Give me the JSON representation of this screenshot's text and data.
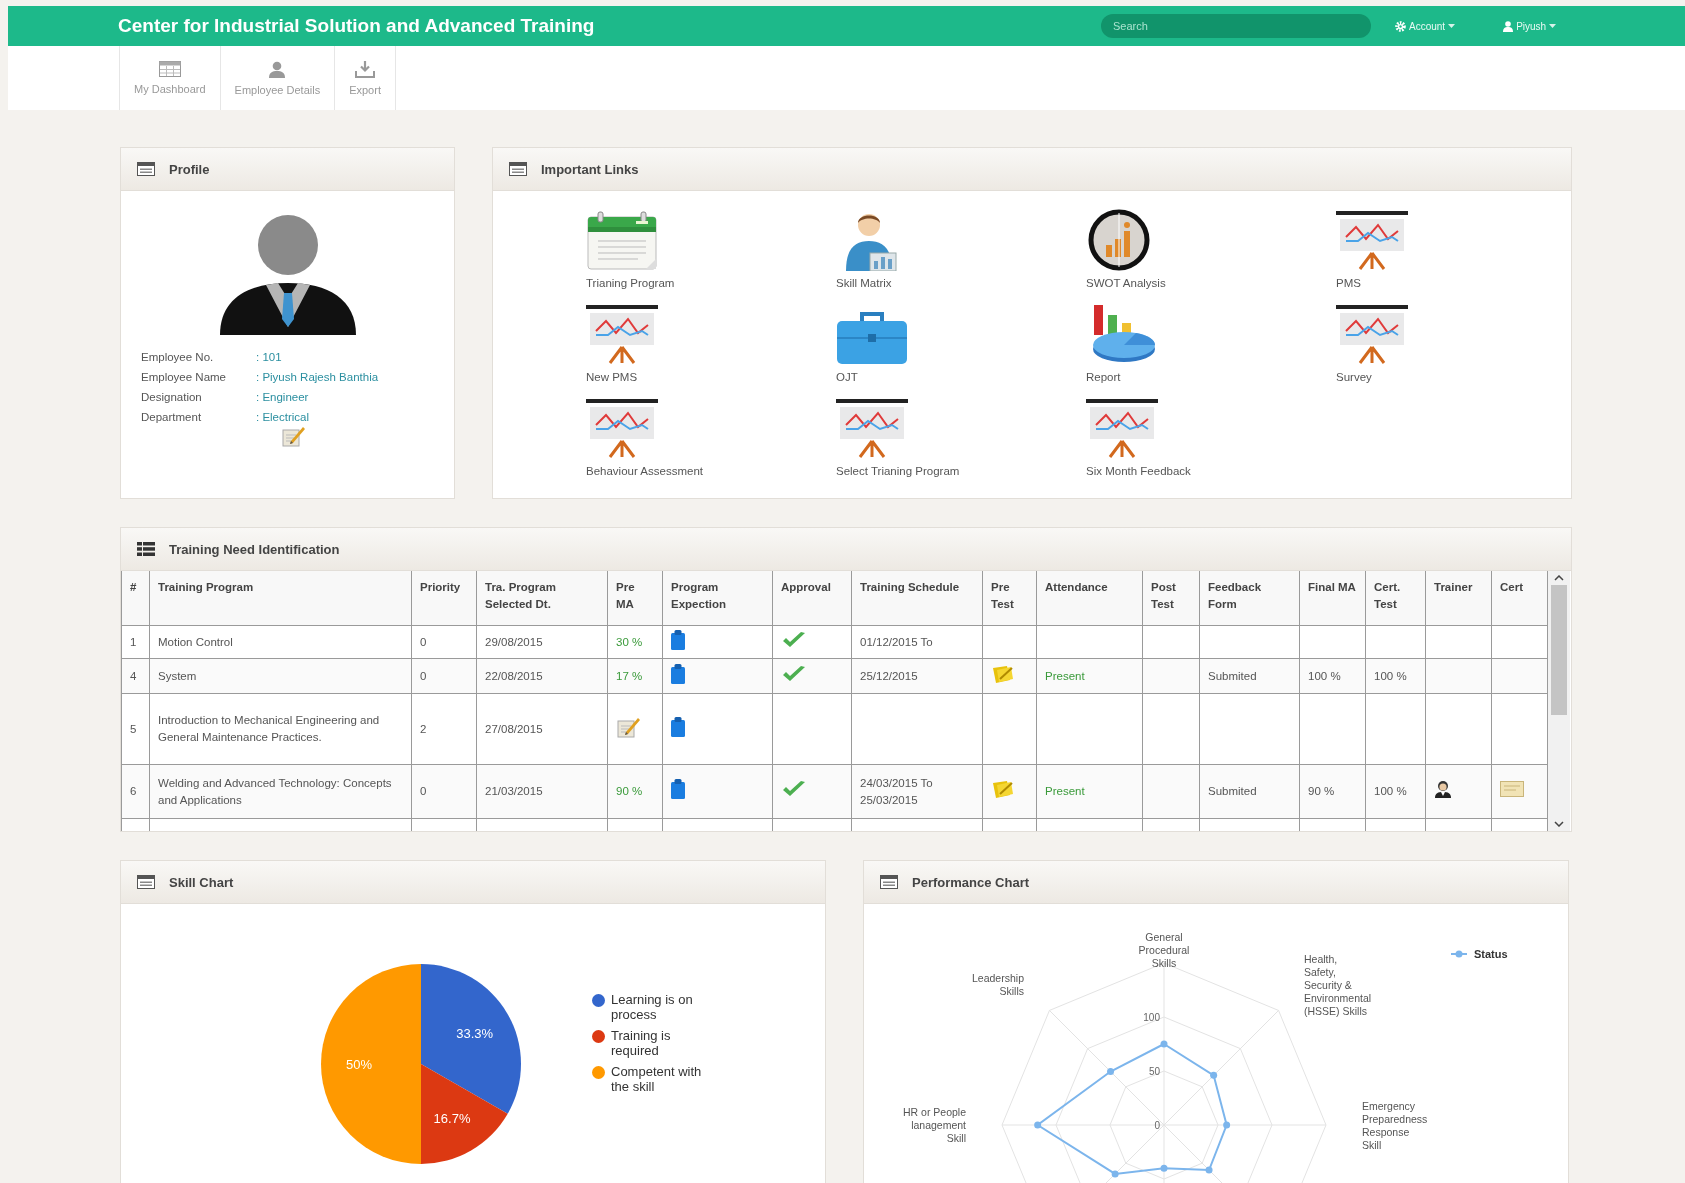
{
  "header": {
    "title": "Center for Industrial Solution and Advanced Training",
    "search": {
      "placeholder": "Search"
    },
    "menus": [
      {
        "kind": "account",
        "label": "Account"
      },
      {
        "kind": "user",
        "label": "Piyush"
      }
    ]
  },
  "toolbar": [
    {
      "kind": "dashboard",
      "label": "My Dashboard"
    },
    {
      "kind": "employee",
      "label": "Employee Details"
    },
    {
      "kind": "export",
      "label": "Export"
    }
  ],
  "profile": {
    "title": "Profile",
    "fields": [
      {
        "label": "Employee No.",
        "value": ": 101"
      },
      {
        "label": "Employee Name",
        "value": ": Piyush Rajesh Banthia"
      },
      {
        "label": "Designation",
        "value": ": Engineer"
      },
      {
        "label": "Department",
        "value": ": Electrical"
      }
    ]
  },
  "links": {
    "title": "Important Links",
    "items": [
      {
        "kind": "calendar",
        "label": "Trianing Program"
      },
      {
        "kind": "person",
        "label": "Skill Matrix"
      },
      {
        "kind": "swot",
        "label": "SWOT Analysis"
      },
      {
        "kind": "presentation",
        "label": "PMS"
      },
      {
        "kind": "presentation",
        "label": "New PMS"
      },
      {
        "kind": "briefcase",
        "label": "OJT"
      },
      {
        "kind": "report",
        "label": "Report"
      },
      {
        "kind": "presentation",
        "label": "Survey"
      },
      {
        "kind": "presentation",
        "label": "Behaviour Assessment"
      },
      {
        "kind": "presentation",
        "label": "Select Trianing Program"
      },
      {
        "kind": "presentation",
        "label": "Six Month Feedback"
      }
    ]
  },
  "tni": {
    "title": "Training Need Identification",
    "table": {
      "columns": [
        "#",
        "Training Program",
        "Priority",
        "Tra. Program Selected Dt.",
        "Pre MA",
        "Program Expection",
        "Approval",
        "Training Schedule",
        "Pre Test",
        "Attendance",
        "Post Test",
        "Feedback Form",
        "Final MA",
        "Cert. Test",
        "Trainer",
        "Cert"
      ],
      "rows": [
        {
          "cells": [
            {
              "kind": "text",
              "text": "1"
            },
            {
              "kind": "text",
              "text": "Motion Control"
            },
            {
              "kind": "text",
              "text": "0"
            },
            {
              "kind": "text",
              "text": "29/08/2015"
            },
            {
              "kind": "good",
              "text": "30 %"
            },
            {
              "kind": "clipboard"
            },
            {
              "kind": "check"
            },
            {
              "kind": "text",
              "text": "01/12/2015 To"
            },
            {
              "kind": "empty"
            },
            {
              "kind": "empty"
            },
            {
              "kind": "empty"
            },
            {
              "kind": "empty"
            },
            {
              "kind": "empty"
            },
            {
              "kind": "empty"
            },
            {
              "kind": "empty"
            },
            {
              "kind": "empty"
            }
          ]
        },
        {
          "cells": [
            {
              "kind": "text",
              "text": "4"
            },
            {
              "kind": "text",
              "text": "System"
            },
            {
              "kind": "text",
              "text": "0"
            },
            {
              "kind": "text",
              "text": "22/08/2015"
            },
            {
              "kind": "good",
              "text": "17 %"
            },
            {
              "kind": "clipboard"
            },
            {
              "kind": "check"
            },
            {
              "kind": "text",
              "text": "25/12/2015"
            },
            {
              "kind": "note"
            },
            {
              "kind": "good",
              "text": "Present"
            },
            {
              "kind": "empty"
            },
            {
              "kind": "text",
              "text": "Submited"
            },
            {
              "kind": "text",
              "text": "100 %"
            },
            {
              "kind": "text",
              "text": "100 %"
            },
            {
              "kind": "empty"
            },
            {
              "kind": "empty"
            }
          ]
        },
        {
          "cells": [
            {
              "kind": "text",
              "text": "5"
            },
            {
              "kind": "text",
              "text": "Introduction to Mechanical Engineering and General Maintenance Practices."
            },
            {
              "kind": "text",
              "text": "2"
            },
            {
              "kind": "text",
              "text": "27/08/2015"
            },
            {
              "kind": "edit"
            },
            {
              "kind": "clipboard"
            },
            {
              "kind": "empty"
            },
            {
              "kind": "empty"
            },
            {
              "kind": "empty"
            },
            {
              "kind": "empty"
            },
            {
              "kind": "empty"
            },
            {
              "kind": "empty"
            },
            {
              "kind": "empty"
            },
            {
              "kind": "empty"
            },
            {
              "kind": "empty"
            },
            {
              "kind": "empty"
            }
          ]
        },
        {
          "cells": [
            {
              "kind": "text",
              "text": "6"
            },
            {
              "kind": "text",
              "text": "Welding and Advanced Technology: Concepts and Applications"
            },
            {
              "kind": "text",
              "text": "0"
            },
            {
              "kind": "text",
              "text": "21/03/2015"
            },
            {
              "kind": "good",
              "text": "90 %"
            },
            {
              "kind": "clipboard"
            },
            {
              "kind": "check"
            },
            {
              "kind": "text",
              "text": "24/03/2015 To 25/03/2015"
            },
            {
              "kind": "note"
            },
            {
              "kind": "good",
              "text": "Present"
            },
            {
              "kind": "empty"
            },
            {
              "kind": "text",
              "text": "Submited"
            },
            {
              "kind": "text",
              "text": "90 %"
            },
            {
              "kind": "text",
              "text": "100 %"
            },
            {
              "kind": "trainer"
            },
            {
              "kind": "cert"
            }
          ]
        }
      ]
    }
  },
  "skill_chart": {
    "title": "Skill Chart",
    "chart_data": {
      "type": "pie",
      "categories": [
        "Learning is on process",
        "Training is required",
        "Competent with the skill"
      ],
      "values": [
        33.3,
        16.7,
        50
      ],
      "colors": [
        "#3366cc",
        "#dc3912",
        "#ff9900"
      ],
      "value_labels": [
        "33.3%",
        "16.7%",
        "50%"
      ],
      "legend": "right"
    }
  },
  "performance_chart": {
    "title": "Performance Chart",
    "axis_labels": [
      "General Procedural Skills",
      "Leadership Skills",
      "Health, Safety, Security & Environmental (HSSE) Skills",
      "HR or People lanagement Skill",
      "Emergency Preparedness Response Skill"
    ],
    "tick_labels": [
      "100",
      "50",
      "0"
    ],
    "legend": {
      "name": "Status",
      "color": "#7cb5ec"
    }
  }
}
